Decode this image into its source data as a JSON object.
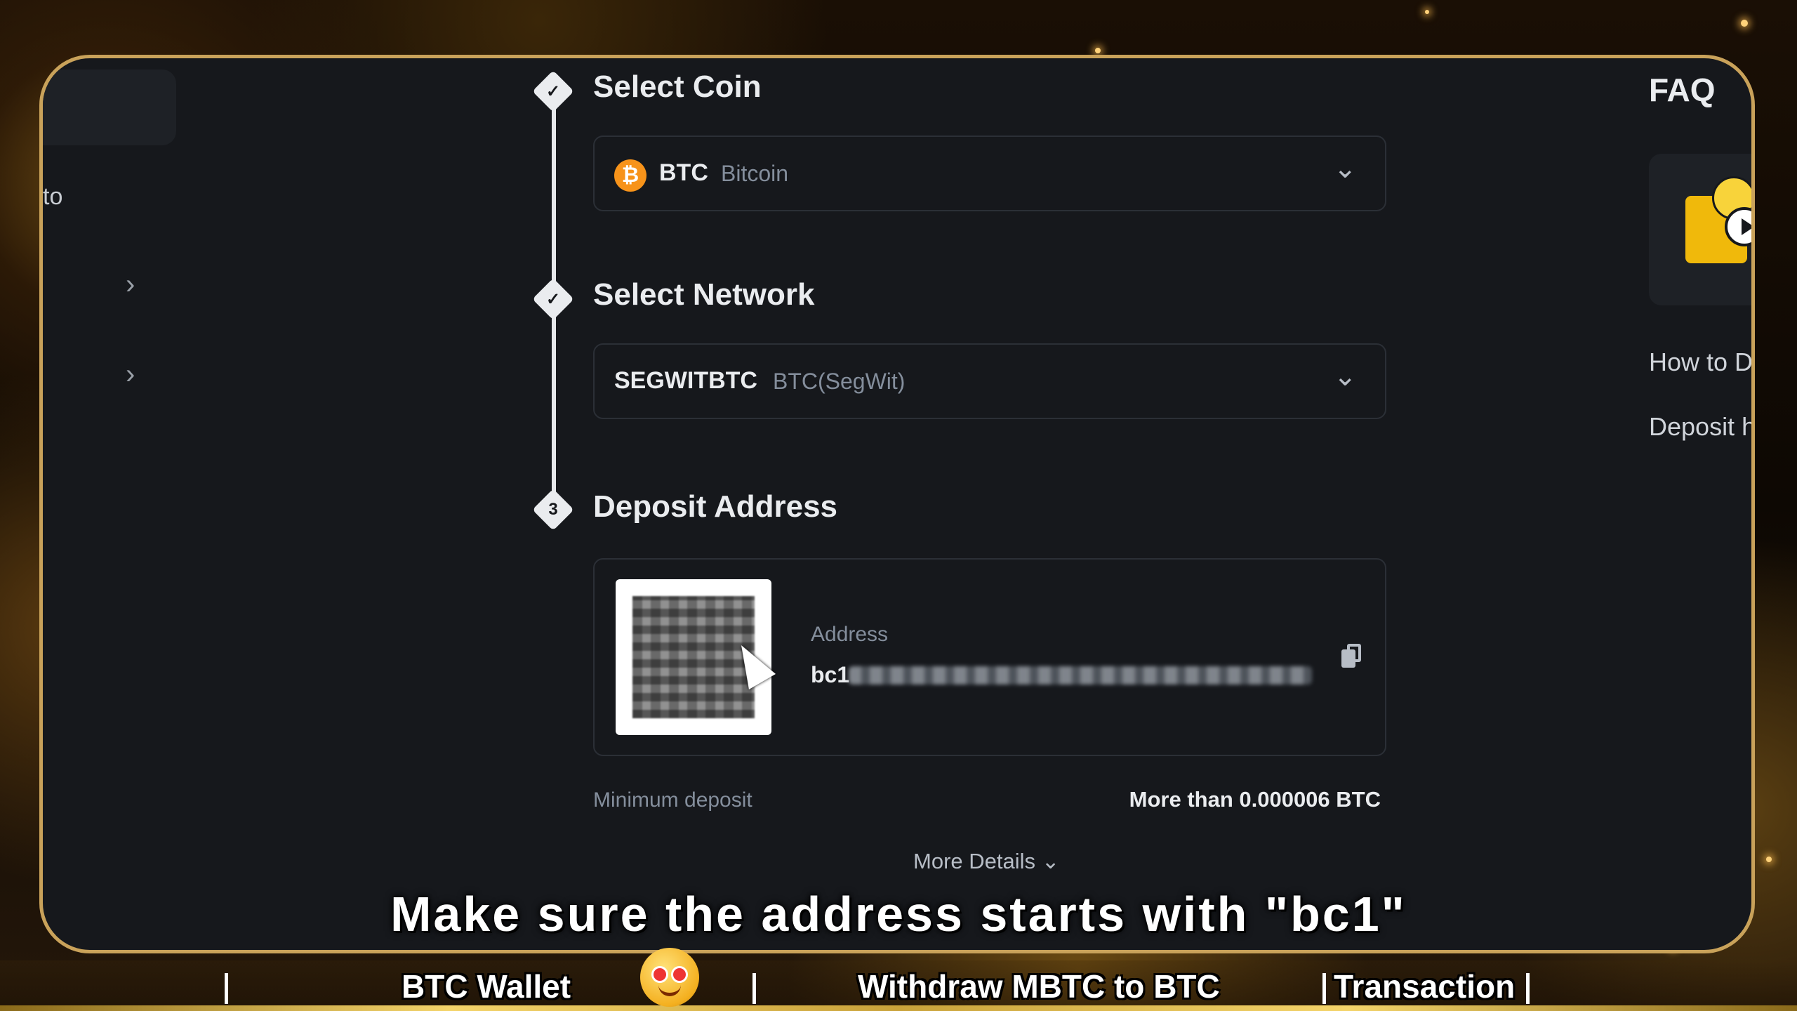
{
  "steps": [
    {
      "title": "Select Coin",
      "icon": "check-icon"
    },
    {
      "title": "Select Network",
      "icon": "check-icon"
    },
    {
      "title": "Deposit Address",
      "number": "3"
    }
  ],
  "coin_select": {
    "symbol": "BTC",
    "name": "Bitcoin",
    "icon_letter": "₿"
  },
  "network_select": {
    "code": "SEGWITBTC",
    "name": "BTC(SegWit)"
  },
  "deposit": {
    "address_label": "Address",
    "address_prefix": "bc1",
    "min_deposit_label": "Minimum deposit",
    "min_deposit_value": "More than 0.000006 BTC",
    "more_details": "More Details ⌄"
  },
  "left_panel": {
    "partial_text": "to"
  },
  "faq": {
    "title": "FAQ",
    "links": [
      "How to D",
      "Deposit h"
    ]
  },
  "subtitle": "Make sure the address starts with \"bc1\"",
  "bottom_bar": {
    "items": [
      "BTC Wallet",
      "Withdraw MBTC to BTC",
      "Transaction"
    ]
  },
  "colors": {
    "frame_border": "#c9a25a",
    "panel_bg": "#16181c",
    "btc_orange": "#f7931a",
    "accent_gold": "#f0b90b"
  }
}
